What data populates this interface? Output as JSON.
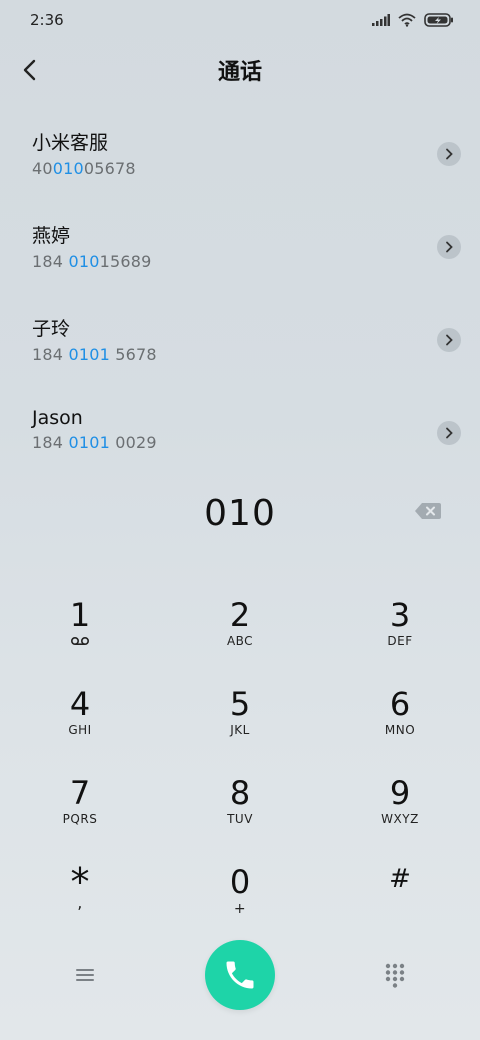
{
  "status": {
    "time": "2:36"
  },
  "header": {
    "title": "通话"
  },
  "contacts": [
    {
      "name": "小米客服",
      "num_pre": "40",
      "num_hl": "010",
      "num_post": "05678"
    },
    {
      "name": "燕婷",
      "num_pre": "184 ",
      "num_hl": "010",
      "num_post": "15689"
    },
    {
      "name": "子玲",
      "num_pre": "184 ",
      "num_hl": "0101",
      "num_post": " 5678"
    },
    {
      "name": "Jason",
      "num_pre": "184 ",
      "num_hl": "0101",
      "num_post": " 0029"
    }
  ],
  "dialer": {
    "input": "010"
  },
  "keys": [
    {
      "digit": "1",
      "letters": ""
    },
    {
      "digit": "2",
      "letters": "ABC"
    },
    {
      "digit": "3",
      "letters": "DEF"
    },
    {
      "digit": "4",
      "letters": "GHI"
    },
    {
      "digit": "5",
      "letters": "JKL"
    },
    {
      "digit": "6",
      "letters": "MNO"
    },
    {
      "digit": "7",
      "letters": "PQRS"
    },
    {
      "digit": "8",
      "letters": "TUV"
    },
    {
      "digit": "9",
      "letters": "WXYZ"
    },
    {
      "digit": "*",
      "letters": ","
    },
    {
      "digit": "0",
      "letters": "+"
    },
    {
      "digit": "#",
      "letters": ""
    }
  ],
  "icons": {
    "back": "back-chevron-icon",
    "voicemail": "voicemail-icon",
    "call": "phone-icon",
    "menu": "menu-icon",
    "dialpad": "dialpad-icon"
  },
  "colors": {
    "accent_highlight": "#1f8fe5",
    "call_button": "#1ed4a8"
  }
}
